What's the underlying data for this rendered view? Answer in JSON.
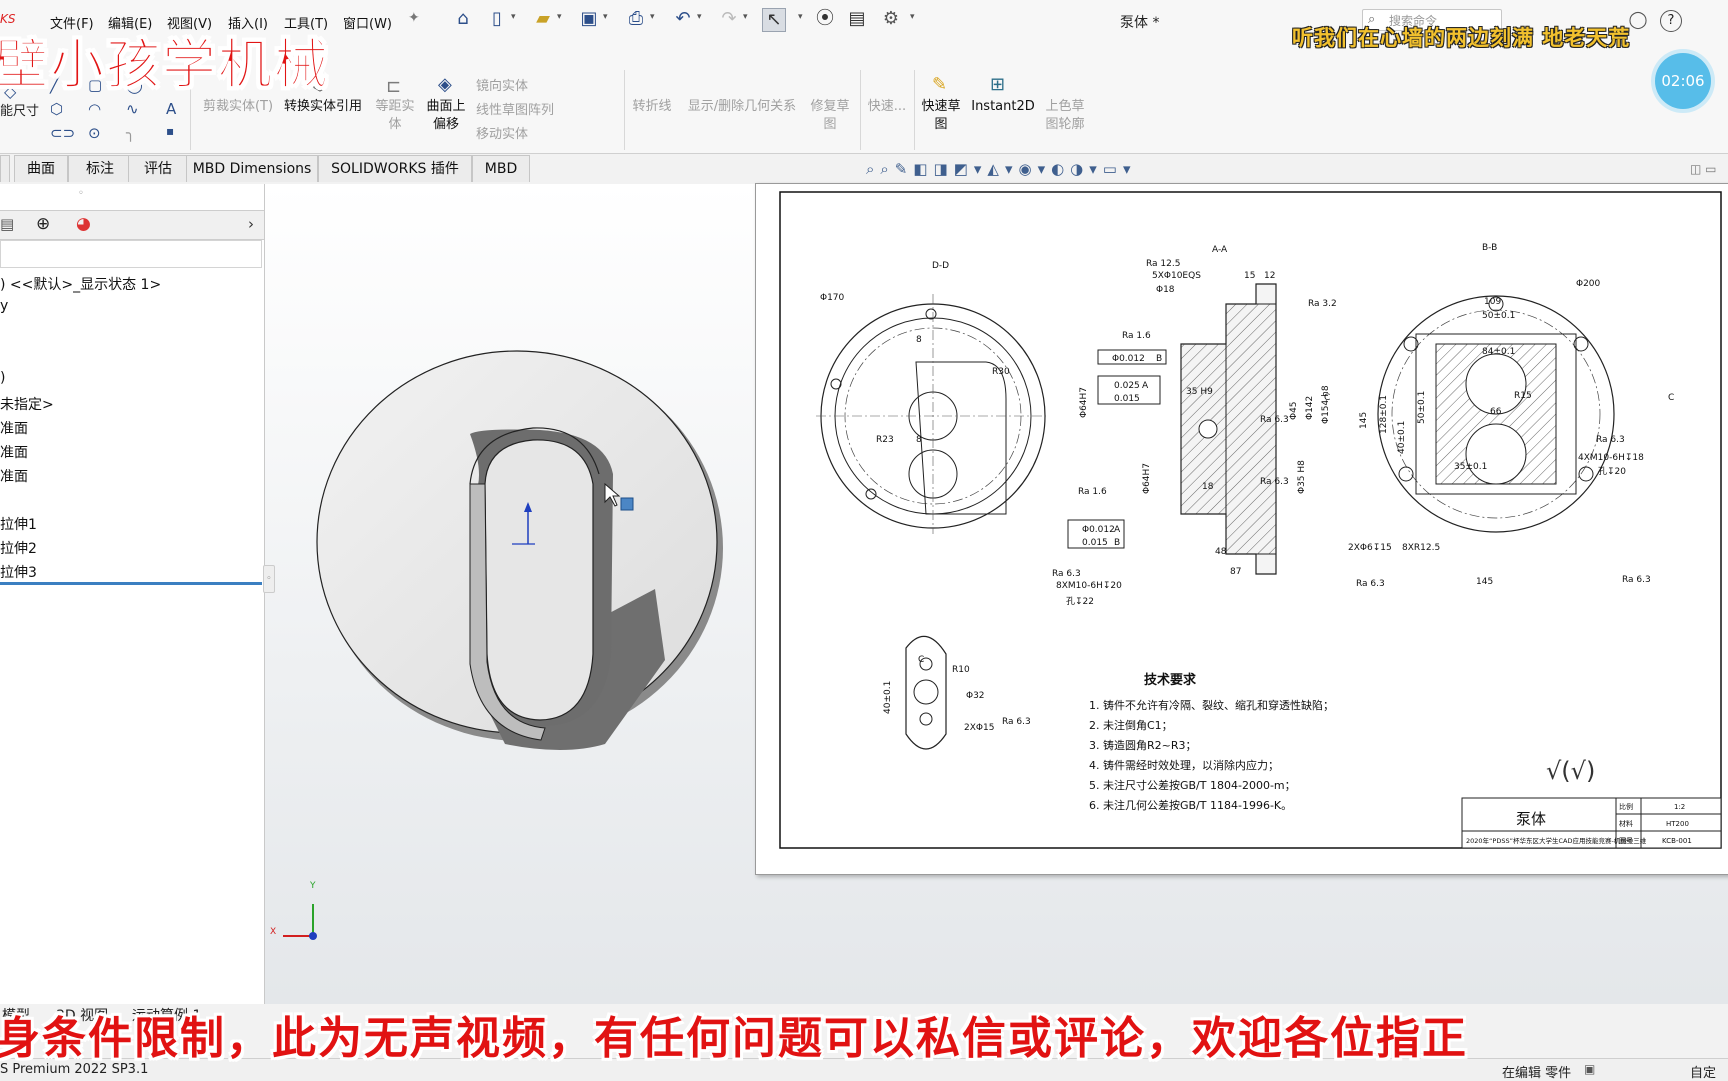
{
  "menubar": {
    "brand": "KS",
    "items": [
      "文件(F)",
      "编辑(E)",
      "视图(V)",
      "插入(I)",
      "工具(T)",
      "窗口(W)"
    ],
    "doc_title": "泵体 *",
    "search_placeholder": "搜索命令"
  },
  "overlay": {
    "channel": "壁小孩学机械",
    "lyric": "听我们在心墙的两边刻满 地老天荒",
    "clock": "02:06",
    "subtitle": "身条件限制，此为无声视频，有任何问题可以私信或评论，欢迎各位指正"
  },
  "cmd": {
    "smart_dim": "能尺寸",
    "trim": "剪裁实体(T)",
    "convert": "转换实体引用",
    "offset": "等距实体",
    "surface_offset": "曲面上偏移",
    "mirror": "镜向实体",
    "linear_pattern": "线性草图阵列",
    "move": "移动实体",
    "construction": "转折线",
    "relations": "显示/删除几何关系",
    "repair": "修复草图",
    "quick_snap": "快速...",
    "quick_sketch": "快速草图",
    "instant2d": "Instant2D",
    "shaded": "上色草图轮廓"
  },
  "tabs": [
    "曲面",
    "标注",
    "评估",
    "MBD Dimensions",
    "SOLIDWORKS 插件",
    "MBD"
  ],
  "tree": {
    "config": ") <<默认>_显示状态 1>",
    "history": "y",
    "sensors": ")",
    "material": "未指定>",
    "plane1": "准面",
    "plane2": "准面",
    "plane3": "准面",
    "boss1": "拉伸1",
    "boss2": "拉伸2",
    "boss3": "拉伸3"
  },
  "model_tabs": [
    "模型",
    "3D 视图",
    "运动算例 1"
  ],
  "status": {
    "version": "S Premium 2022 SP3.1",
    "mode": "在编辑 零件",
    "custom": "自定"
  },
  "drawing": {
    "view_dd": "D-D",
    "view_aa": "A-A",
    "view_bb": "B-B",
    "view_c": "C",
    "tech_title": "技术要求",
    "tech_notes": [
      "1. 铸件不允许有冷隔、裂纹、缩孔和穿透性缺陷；",
      "2. 未注倒角C1；",
      "3. 铸造圆角R2~R3；",
      "4. 铸件需经时效处理，以消除内应力；",
      "5. 未注尺寸公差按GB/T 1804-2000-m；",
      "6. 未注几何公差按GB/T 1184-1996-K。"
    ],
    "part_name": "泵体",
    "scale_label": "比例",
    "scale_value": "1:2",
    "material_label": "材料",
    "material_value": "HT200",
    "drawing_no_label": "图号",
    "drawing_no_value": "KCB-001",
    "competition": "2020年“PDSS”杯华东区大学生CAD应用技能竞赛-机械类三维",
    "roughness": "√(√)",
    "dims": {
      "d170": "Φ170",
      "r30": "R30",
      "r23": "R23",
      "n8": "8",
      "ra125": "Ra 12.5",
      "eqs": "5XΦ10EQS",
      "d18": "Φ18",
      "d15": "15",
      "d12": "12",
      "ra32": "Ra 3.2",
      "ra16": "Ra 1.6",
      "tol012": "Φ0.012",
      "tolB": "B",
      "t025": "0.025",
      "tA": "A",
      "t015": "0.015",
      "h35": "35 H9",
      "d45": "Φ45",
      "d142": "Φ142",
      "d154": "Φ154 h8",
      "d35": "Φ35 H8",
      "d64": "Φ64H7",
      "ra63": "Ra 6.3",
      "n18": "18",
      "n48": "48",
      "n87": "87",
      "thread1": "8XM10-6H↧20",
      "depth22": "孔↧22",
      "d200": "Φ200",
      "n109": "109",
      "n50": "50±0.1",
      "n84": "84±0.1",
      "n66": "66",
      "r15": "R15",
      "n145": "145",
      "n128": "128±0.1",
      "n40": "40±0.1",
      "n35": "35±0.1",
      "thread2": "4XM10-6H↧18",
      "depth20": "孔↧20",
      "holes2": "2XΦ6↧15",
      "r125": "8XR12.5",
      "r10": "R10",
      "d32": "Φ32",
      "holes3": "2XΦ15",
      "n40b": "40±0.1"
    }
  }
}
